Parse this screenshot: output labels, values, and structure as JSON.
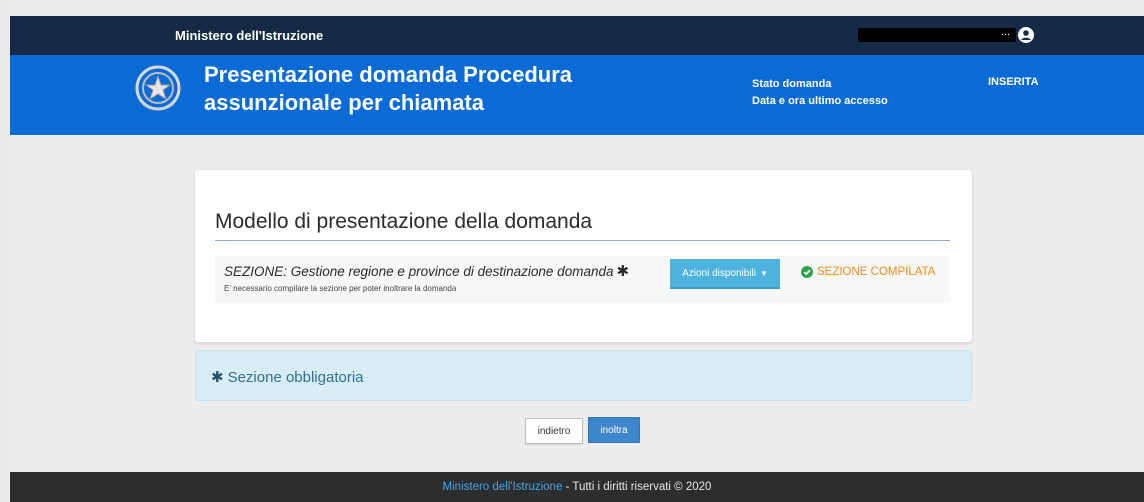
{
  "topbar": {
    "org_name": "Ministero dell'Istruzione"
  },
  "header": {
    "title_line1": "Presentazione domanda Procedura",
    "title_line2": "assunzionale per chiamata",
    "status_label": "Stato domanda",
    "last_access_label": "Data e ora ultimo accesso",
    "status_value": "INSERITA"
  },
  "card": {
    "title": "Modello di presentazione della domanda",
    "section": {
      "title": "SEZIONE: Gestione regione e province di destinazione domanda",
      "star": "✱",
      "note": "E' necessario compilare la sezione per poter inoltrare la domanda",
      "actions_label": "Azioni disponibili",
      "status": "SEZIONE COMPILATA"
    }
  },
  "info": {
    "star": "✱",
    "text": "Sezione obbligatoria"
  },
  "buttons": {
    "back_label": "indietro",
    "send_label": "inoltra"
  },
  "footer": {
    "link_text": "Ministero dell'Istruzione",
    "rest_text": " - Tutti i diritti riservati © 2020"
  },
  "colors": {
    "topbar": "#152b45",
    "header": "#0b6bd6",
    "status_compilata": "#f08c1f",
    "check_green": "#2ea44f",
    "actions_button": "#4fb3e0",
    "send_button": "#3e86cb",
    "info_bg": "#d9edf6",
    "footer": "#2b2d2f"
  },
  "icons": {
    "user": "user-circle-icon",
    "emblem": "republic-emblem-icon",
    "check": "check-circle-icon",
    "caret": "caret-down-icon",
    "required": "asterisk-icon"
  }
}
